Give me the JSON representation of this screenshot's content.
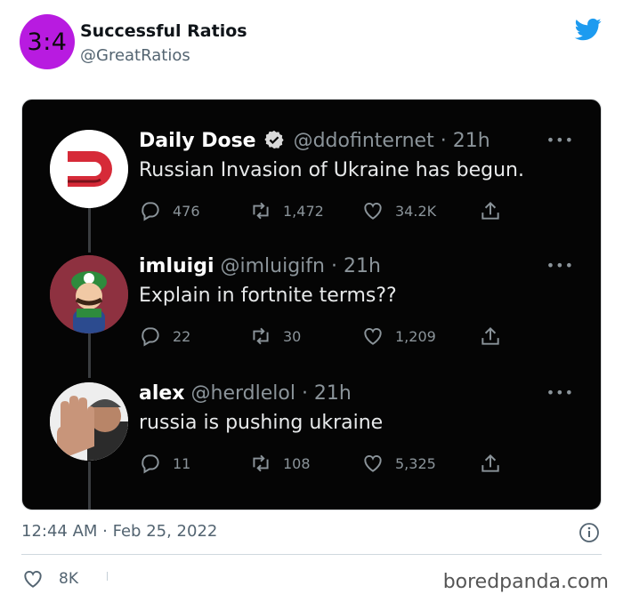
{
  "outer": {
    "avatar_text": "3:4",
    "name": "Successful Ratios",
    "handle": "@GreatRatios",
    "timestamp": "12:44 AM · Feb 25, 2022",
    "likes": "8K",
    "watermark": "boredpanda.com",
    "colors": {
      "avatar_bg": "#b81be0",
      "twitter_blue": "#1d9bf0"
    }
  },
  "tweets": [
    {
      "name": "Daily Dose",
      "verified": true,
      "handle": "@ddofinternet",
      "time": "· 21h",
      "text": "Russian Invasion of Ukraine has begun.",
      "replies": "476",
      "retweets": "1,472",
      "likes": "34.2K"
    },
    {
      "name": "imluigi",
      "verified": false,
      "handle": "@imluigifn",
      "time": "· 21h",
      "text": "Explain in fortnite terms??",
      "replies": "22",
      "retweets": "30",
      "likes": "1,209"
    },
    {
      "name": "alex",
      "verified": false,
      "handle": "@herdlelol",
      "time": "· 21h",
      "text": "russia is pushing ukraine",
      "replies": "11",
      "retweets": "108",
      "likes": "5,325"
    }
  ],
  "icons": {
    "more": "more-dots-icon",
    "reply": "reply-icon",
    "retweet": "retweet-icon",
    "like": "heart-icon",
    "share": "share-icon",
    "info": "info-icon",
    "brand": "twitter-bird-icon"
  }
}
